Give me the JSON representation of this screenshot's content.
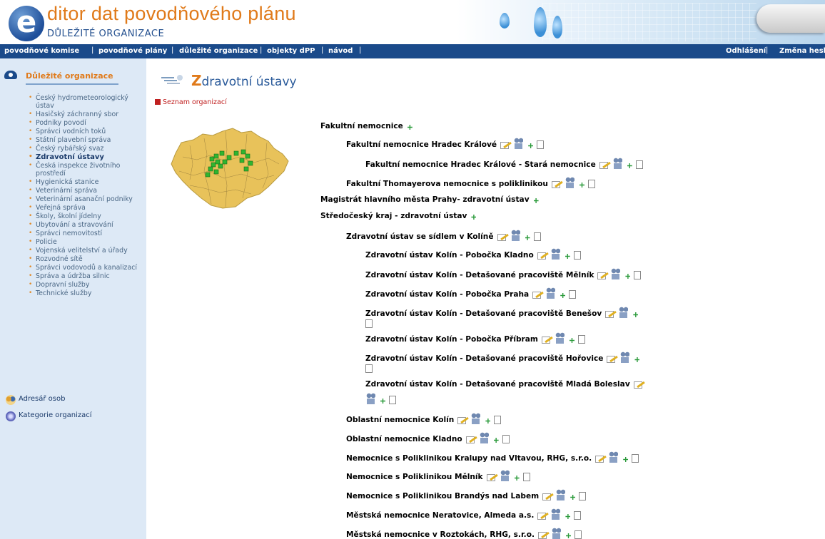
{
  "header": {
    "logo_letter": "e",
    "title": "ditor dat povodňového plánu",
    "subtitle": "DŮLEŽITÉ ORGANIZACE"
  },
  "topnav": {
    "left": [
      "povodňové komise",
      "povodňové plány",
      "důležité organizace",
      "objekty dPP",
      "návod"
    ],
    "right": [
      "Odhlášení",
      "Změna hesla"
    ]
  },
  "sidebar": {
    "title": "Důležité organizace",
    "items": [
      "Český hydrometeorologický ústav",
      "Hasičský záchranný sbor",
      "Podniky povodí",
      "Správci vodních toků",
      "Státní plavební správa",
      "Český rybářský svaz",
      "Zdravotní ústavy",
      "Česká inspekce životního prostředí",
      "Hygienická stanice",
      "Veterinární správa",
      "Veterinární asanační podniky",
      "Veřejná správa",
      "Školy, školní jídelny",
      "Ubytování a stravování",
      "Správci nemovitostí",
      "Policie",
      "Vojenská velitelství a úřady",
      "Rozvodné sítě",
      "Správci vodovodů a kanalizací",
      "Správa a údržba silnic",
      "Dopravní služby",
      "Technické služby"
    ],
    "active_index": 6,
    "extra": [
      "Adresář osob",
      "Kategorie organizací"
    ]
  },
  "main": {
    "title_first": "Z",
    "title_rest": "dravotní ústavy",
    "list_link": "Seznam organizací",
    "tree": [
      {
        "label": "Fakultní nemocnice",
        "icons": "add"
      },
      {
        "label": "Fakultní nemocnice Hradec Králové",
        "icons": "full"
      },
      {
        "label": "Fakultní nemocnice Hradec Králové - Stará nemocnice",
        "icons": "full"
      },
      {
        "label": "Fakultní Thomayerova nemocnice s poliklinikou",
        "icons": "full"
      },
      {
        "label": "Magistrát hlavního města Prahy- zdravotní ústav",
        "icons": "add"
      },
      {
        "label": "Středočeský kraj - zdravotní ústav",
        "icons": "add"
      },
      {
        "label": "Zdravotní ústav se sídlem v Kolíně",
        "icons": "full"
      },
      {
        "label": "Zdravotní ústav Kolín - Pobočka Kladno",
        "icons": "full"
      },
      {
        "label": "Zdravotní ústav Kolín - Detašované pracoviště Mělník",
        "icons": "full"
      },
      {
        "label": "Zdravotní ústav Kolín - Pobočka Praha",
        "icons": "full"
      },
      {
        "label": "Zdravotní ústav Kolín - Detašované pracoviště Benešov",
        "icons": "wrap-doc"
      },
      {
        "label": "Zdravotní ústav Kolín - Pobočka Příbram",
        "icons": "full"
      },
      {
        "label": "Zdravotní ústav Kolín - Detašované pracoviště Hořovice",
        "icons": "wrap-doc"
      },
      {
        "label": "Zdravotní ústav Kolín - Detašované pracoviště Mladá Boleslav",
        "icons": "wrap-three"
      },
      {
        "label": "Oblastní nemocnice Kolín",
        "icons": "full"
      },
      {
        "label": "Oblastní nemocnice Kladno",
        "icons": "full"
      },
      {
        "label": "Nemocnice s Poliklinikou Kralupy nad Vltavou, RHG, s.r.o.",
        "icons": "full"
      },
      {
        "label": "Nemocnice s Poliklinikou Mělník",
        "icons": "full"
      },
      {
        "label": "Nemocnice s Poliklinikou Brandýs nad Labem",
        "icons": "full"
      },
      {
        "label": "Městská nemocnice Neratovice, Almeda a.s.",
        "icons": "full"
      },
      {
        "label": "Městská nemocnice v Roztokách, RHG, s.r.o.",
        "icons": "full"
      }
    ]
  }
}
